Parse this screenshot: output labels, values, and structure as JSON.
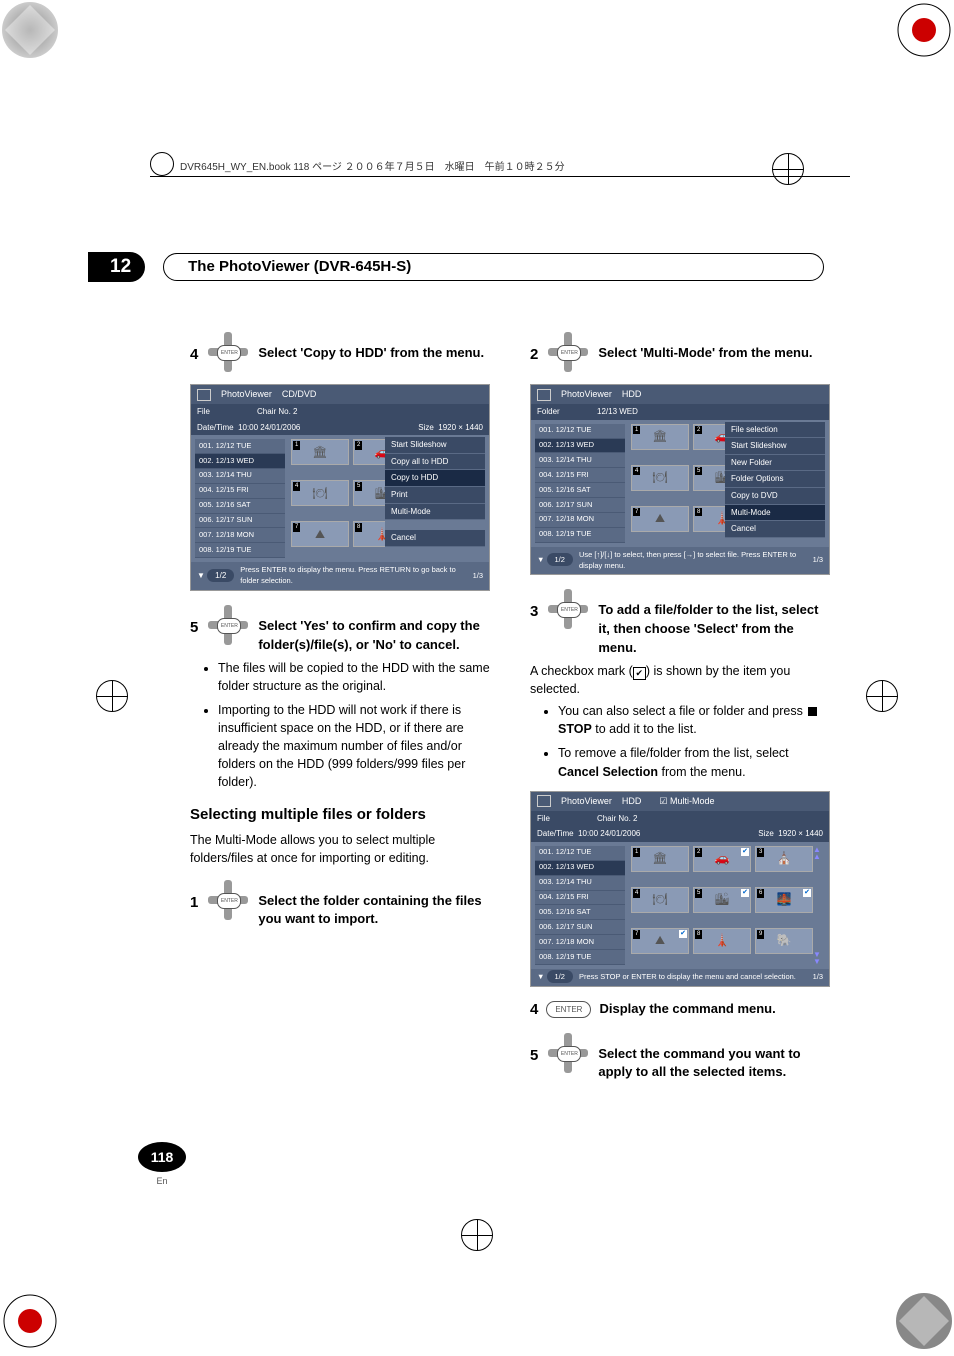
{
  "book_header": "DVR645H_WY_EN.book 118 ページ ２００６年７月５日　水曜日　午前１０時２５分",
  "chapter": {
    "number": "12",
    "title": "The PhotoViewer (DVR-645H-S)"
  },
  "left": {
    "step4": {
      "num": "4",
      "text": "Select 'Copy to HDD' from the menu."
    },
    "ss1": {
      "title_app": "PhotoViewer",
      "title_src": "CD/DVD",
      "sub_file": "File",
      "sub_chair": "Chair No. 2",
      "sub_datetime": "Date/Time",
      "sub_dt_val": "10:00  24/01/2006",
      "sub_size": "Size",
      "sub_size_val": "1920 × 1440",
      "list": [
        "001. 12/12 TUE",
        "002. 12/13 WED",
        "003. 12/14 THU",
        "004. 12/15 FRI",
        "005. 12/16 SAT",
        "006. 12/17 SUN",
        "007. 12/18 MON",
        "008. 12/19 TUE"
      ],
      "menu": [
        "Start Slideshow",
        "Copy all to HDD",
        "Copy to HDD",
        "Print",
        "Multi-Mode",
        "Cancel"
      ],
      "footer_page": "1/2",
      "footer_msg": "Press ENTER to display the menu. Press RETURN to go back to folder selection.",
      "footer_right": "1/3"
    },
    "step5": {
      "num": "5",
      "text": "Select 'Yes' to confirm and copy the folder(s)/file(s), or 'No' to cancel."
    },
    "bullets5": [
      "The files will be copied to the HDD with the same folder structure as the original.",
      "Importing to the HDD will not work if there is insufficient space on the HDD, or if there are already the maximum number of files and/or folders on the HDD (999 folders/999 files per folder)."
    ],
    "h3": "Selecting multiple files or folders",
    "p1": "The Multi-Mode allows you to select multiple folders/files at once for importing or editing.",
    "step1": {
      "num": "1",
      "text": "Select the folder containing the files you want to import."
    }
  },
  "right": {
    "step2": {
      "num": "2",
      "text": "Select 'Multi-Mode' from the menu."
    },
    "ss2": {
      "title_app": "PhotoViewer",
      "title_src": "HDD",
      "sub_folder": "Folder",
      "sub_folder_val": "12/13 WED",
      "list": [
        "001. 12/12 TUE",
        "002. 12/13 WED",
        "003. 12/14 THU",
        "004. 12/15 FRI",
        "005. 12/16 SAT",
        "006. 12/17 SUN",
        "007. 12/18 MON",
        "008. 12/19 TUE"
      ],
      "menu": [
        "File selection",
        "Start Slideshow",
        "New Folder",
        "Folder Options",
        "Copy to DVD",
        "Multi-Mode",
        "Cancel"
      ],
      "footer_page": "1/2",
      "footer_msg": "Use [↑]/[↓] to select, then press [→] to select file. Press ENTER to display menu.",
      "footer_right": "1/3"
    },
    "step3": {
      "num": "3",
      "text": "To add a file/folder to the list, select it, then choose 'Select' from the menu."
    },
    "p3": "A checkbox mark (✔) is shown by the item you selected.",
    "bullets3": [
      "You can also select a file or folder and press ■ STOP to add it to the list.",
      "To remove a file/folder from the list, select Cancel Selection from the menu."
    ],
    "stop_label": "STOP",
    "cancel_sel_label": "Cancel Selection",
    "ss3": {
      "title_app": "PhotoViewer",
      "title_src": "HDD",
      "title_mode": "Multi-Mode",
      "sub_file": "File",
      "sub_chair": "Chair No. 2",
      "sub_datetime": "Date/Time",
      "sub_dt_val": "10:00  24/01/2006",
      "sub_size": "Size",
      "sub_size_val": "1920 × 1440",
      "list": [
        "001. 12/12 TUE",
        "002. 12/13 WED",
        "003. 12/14 THU",
        "004. 12/15 FRI",
        "005. 12/16 SAT",
        "006. 12/17 SUN",
        "007. 12/18 MON",
        "008. 12/19 TUE"
      ],
      "footer_page": "1/2",
      "footer_msg": "Press STOP or ENTER to display the menu and cancel selection.",
      "footer_right": "1/3"
    },
    "step4b": {
      "num": "4",
      "btn": "ENTER",
      "text": "Display the command menu."
    },
    "step5b": {
      "num": "5",
      "text": "Select the command you want to apply to all the selected items."
    }
  },
  "page_number": "118",
  "lang": "En",
  "enter_label": "ENTER"
}
